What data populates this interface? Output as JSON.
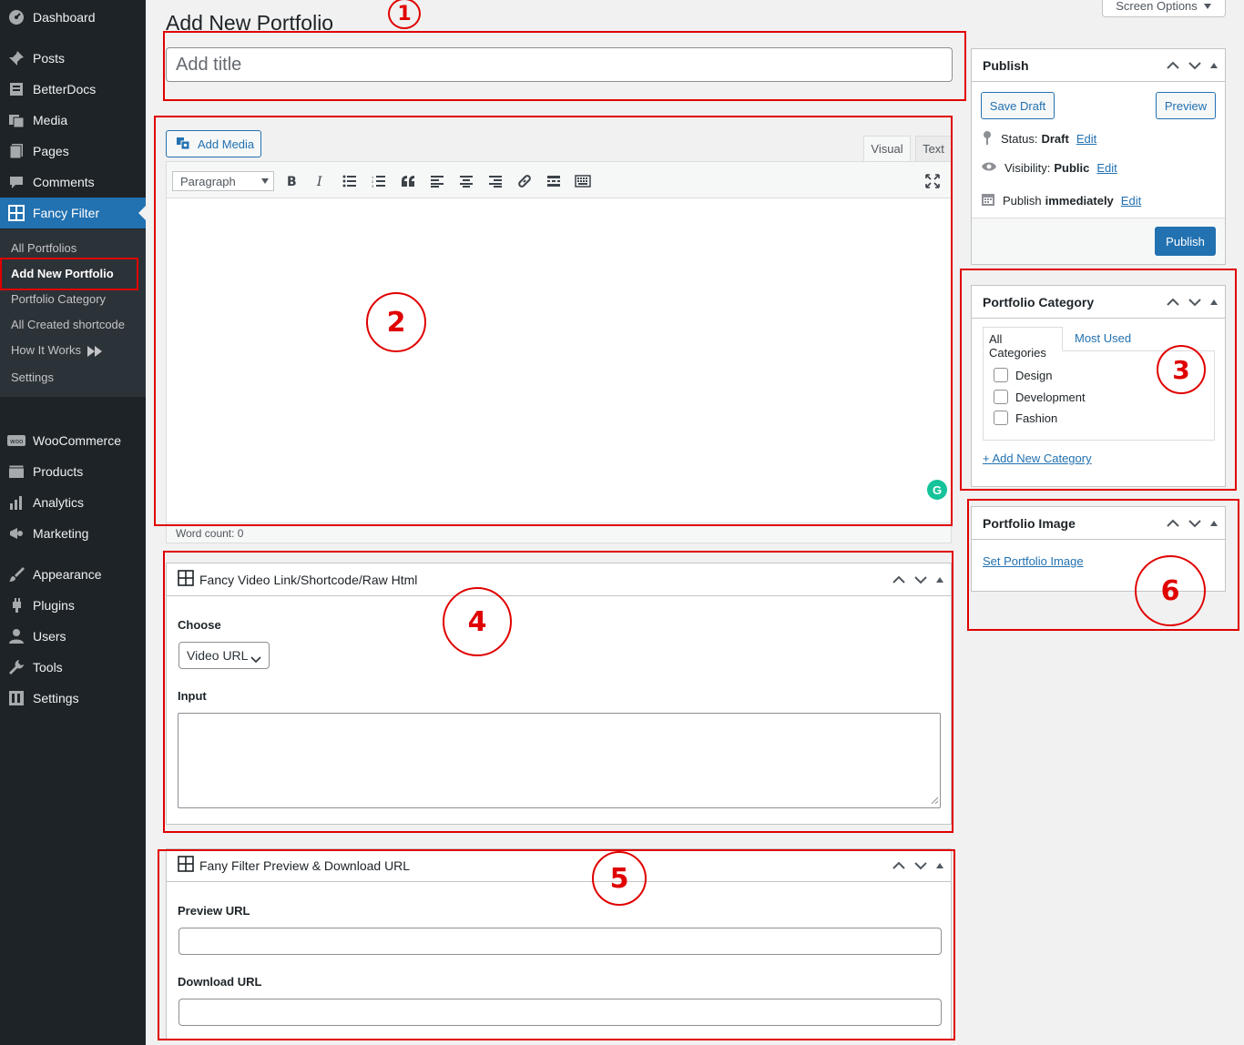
{
  "sidebar": {
    "menu": [
      {
        "label": "Dashboard",
        "icon": "dashboard-icon"
      },
      {
        "label": "Posts",
        "icon": "pin-icon"
      },
      {
        "label": "BetterDocs",
        "icon": "docs-icon"
      },
      {
        "label": "Media",
        "icon": "media-icon"
      },
      {
        "label": "Pages",
        "icon": "pages-icon"
      },
      {
        "label": "Comments",
        "icon": "comments-icon"
      },
      {
        "label": "Fancy Filter",
        "icon": "grid-icon"
      },
      {
        "label": "WooCommerce",
        "icon": "woo-icon"
      },
      {
        "label": "Products",
        "icon": "products-icon"
      },
      {
        "label": "Analytics",
        "icon": "analytics-icon"
      },
      {
        "label": "Marketing",
        "icon": "megaphone-icon"
      },
      {
        "label": "Appearance",
        "icon": "brush-icon"
      },
      {
        "label": "Plugins",
        "icon": "plug-icon"
      },
      {
        "label": "Users",
        "icon": "user-icon"
      },
      {
        "label": "Tools",
        "icon": "wrench-icon"
      },
      {
        "label": "Settings",
        "icon": "settings-icon"
      }
    ],
    "submenu": [
      "All Portfolios",
      "Add New Portfolio",
      "Portfolio Category",
      "All Created shortcode",
      "How It Works",
      "Settings"
    ]
  },
  "header": {
    "title": "Add New Portfolio",
    "screen_options": "Screen Options"
  },
  "title_field": {
    "placeholder": "Add title",
    "value": ""
  },
  "editor": {
    "add_media": "Add Media",
    "tab_visual": "Visual",
    "tab_text": "Text",
    "format": "Paragraph",
    "word_count": "Word count: 0",
    "grammarly": "G"
  },
  "publish": {
    "title": "Publish",
    "save_draft": "Save Draft",
    "preview": "Preview",
    "status_label": "Status:",
    "status_value": "Draft",
    "visibility_label": "Visibility:",
    "visibility_value": "Public",
    "schedule_label": "Publish",
    "schedule_value": "immediately",
    "edit": "Edit",
    "publish_button": "Publish"
  },
  "category": {
    "title": "Portfolio Category",
    "tab_all": "All Categories",
    "tab_most_used": "Most Used",
    "items": [
      "Design",
      "Development",
      "Fashion"
    ],
    "add_new": "+ Add New Category"
  },
  "portfolio_image": {
    "title": "Portfolio Image",
    "set_link": "Set Portfolio Image"
  },
  "video_box": {
    "title": "Fancy Video Link/Shortcode/Raw Html",
    "choose_label": "Choose",
    "choose_value": "Video URL",
    "input_label": "Input"
  },
  "preview_box": {
    "title": "Fany Filter Preview & Download URL",
    "preview_label": "Preview URL",
    "download_label": "Download URL"
  },
  "callouts": [
    "1",
    "2",
    "3",
    "4",
    "5",
    "6"
  ],
  "colors": {
    "sidebar": "#1d2327",
    "accent": "#2271b1",
    "annotation": "#e00000"
  }
}
